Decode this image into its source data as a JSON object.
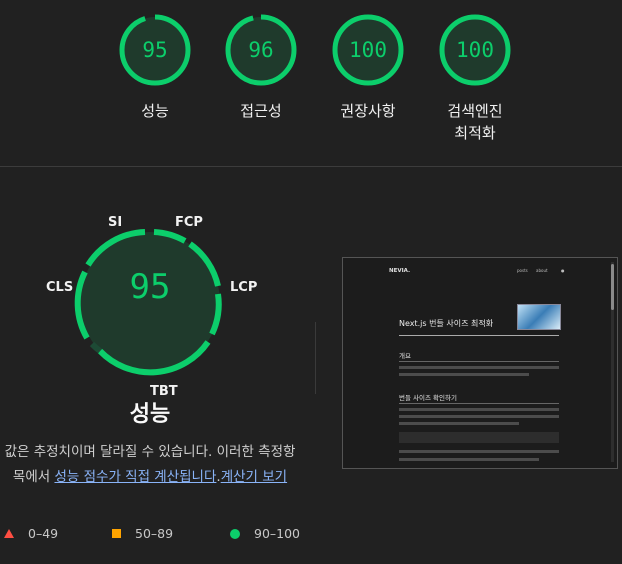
{
  "summary": {
    "gauges": [
      {
        "score": "95",
        "label": "성능",
        "fraction": 0.95
      },
      {
        "score": "96",
        "label": "접근성",
        "fraction": 0.96
      },
      {
        "score": "100",
        "label": "권장사항",
        "fraction": 1.0
      },
      {
        "score": "100",
        "label": "검색엔진\n최적화",
        "fraction": 1.0
      }
    ]
  },
  "performance": {
    "score": "95",
    "title": "성능",
    "metrics": {
      "si": "SI",
      "fcp": "FCP",
      "lcp": "LCP",
      "tbt": "TBT",
      "cls": "CLS"
    },
    "description": {
      "text1": "값은 추정치이며 달라질 수 있습니다. 이러한 측정항목에서 ",
      "link1": "성능 점수가 직접 계산됩니다",
      "text2": ".",
      "link2": "계산기 보기"
    }
  },
  "legend": {
    "fail": "0–49",
    "average": "50–89",
    "pass": "90–100"
  },
  "screenshot": {
    "brand": "NEVIA.",
    "nav": [
      "posts",
      "about"
    ],
    "title": "Next.js 번들 사이즈 최적화",
    "section1": "개요",
    "section2": "번들 사이즈 확인하기"
  },
  "colors": {
    "pass": "#0cce6b",
    "average": "#ffa400",
    "fail": "#ff4e42"
  }
}
